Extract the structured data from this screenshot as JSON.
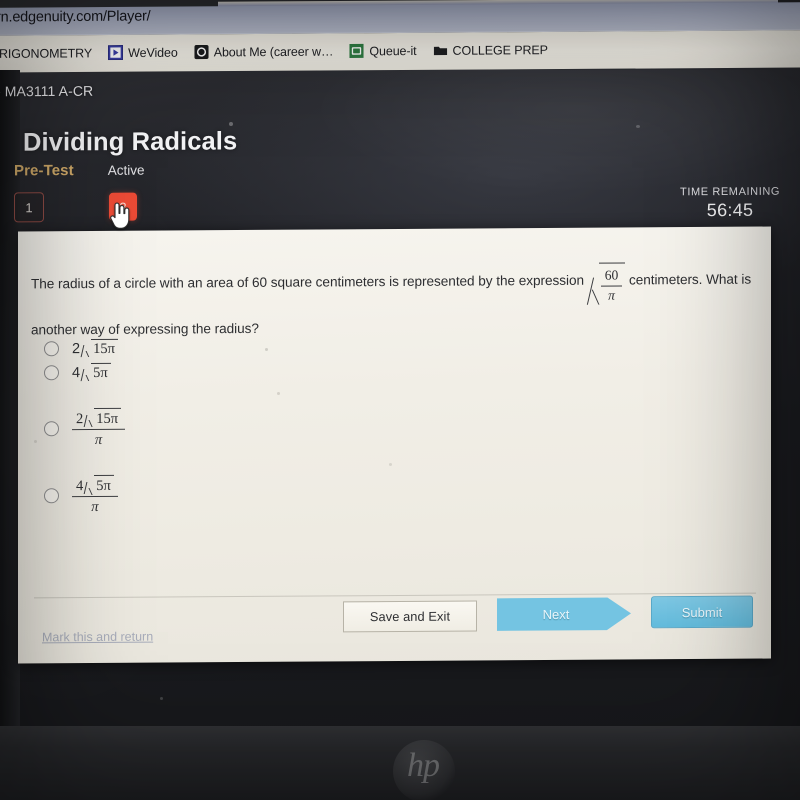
{
  "browser": {
    "url": "rn.edgenuity.com/Player/",
    "bookmarks": [
      {
        "label": "RIGONOMETRY",
        "icon": "none-icon"
      },
      {
        "label": "WeVideo",
        "icon": "wevideo-play-icon"
      },
      {
        "label": "About Me (career w…",
        "icon": "about-me-icon"
      },
      {
        "label": "Queue-it",
        "icon": "queue-it-icon"
      },
      {
        "label": "COLLEGE PREP",
        "icon": "folder-icon"
      }
    ]
  },
  "header": {
    "breadcrumb": "- MA3111 A-CR",
    "title": "Dividing Radicals",
    "stage_label": "Pre-Test",
    "status_label": "Active",
    "stage_color": "#cfa968",
    "question_numbers": [
      {
        "label": "1",
        "state": "outline"
      },
      {
        "label": "3",
        "state": "current"
      }
    ],
    "current_number_color": "#ec4a35",
    "timer_label": "TIME REMAINING",
    "timer_value": "56:45"
  },
  "question": {
    "text_part_1": "The radius of a circle with an area of 60 square centimeters is represented by the expression",
    "expression_numerator": "60",
    "expression_denominator": "π",
    "text_part_2": "centimeters. What is",
    "text_part_3": "another way of expressing the radius?",
    "options": [
      {
        "id": "option-a",
        "kind": "radical",
        "coefficient": "2",
        "radicand": "15π",
        "denominator": null,
        "selected": false
      },
      {
        "id": "option-b",
        "kind": "radical",
        "coefficient": "4",
        "radicand": "5π",
        "denominator": null,
        "selected": false
      },
      {
        "id": "option-c",
        "kind": "fraction",
        "coefficient": "2",
        "radicand": "15π",
        "denominator": "π",
        "selected": false
      },
      {
        "id": "option-d",
        "kind": "fraction",
        "coefficient": "4",
        "radicand": "5π",
        "denominator": "π",
        "selected": false
      }
    ]
  },
  "footer": {
    "mark_link": "Mark this and return",
    "save_label": "Save and Exit",
    "next_label": "Next",
    "submit_label": "Submit",
    "accent_color": "#74c4e2"
  },
  "device": {
    "brand_logo": "hp"
  }
}
